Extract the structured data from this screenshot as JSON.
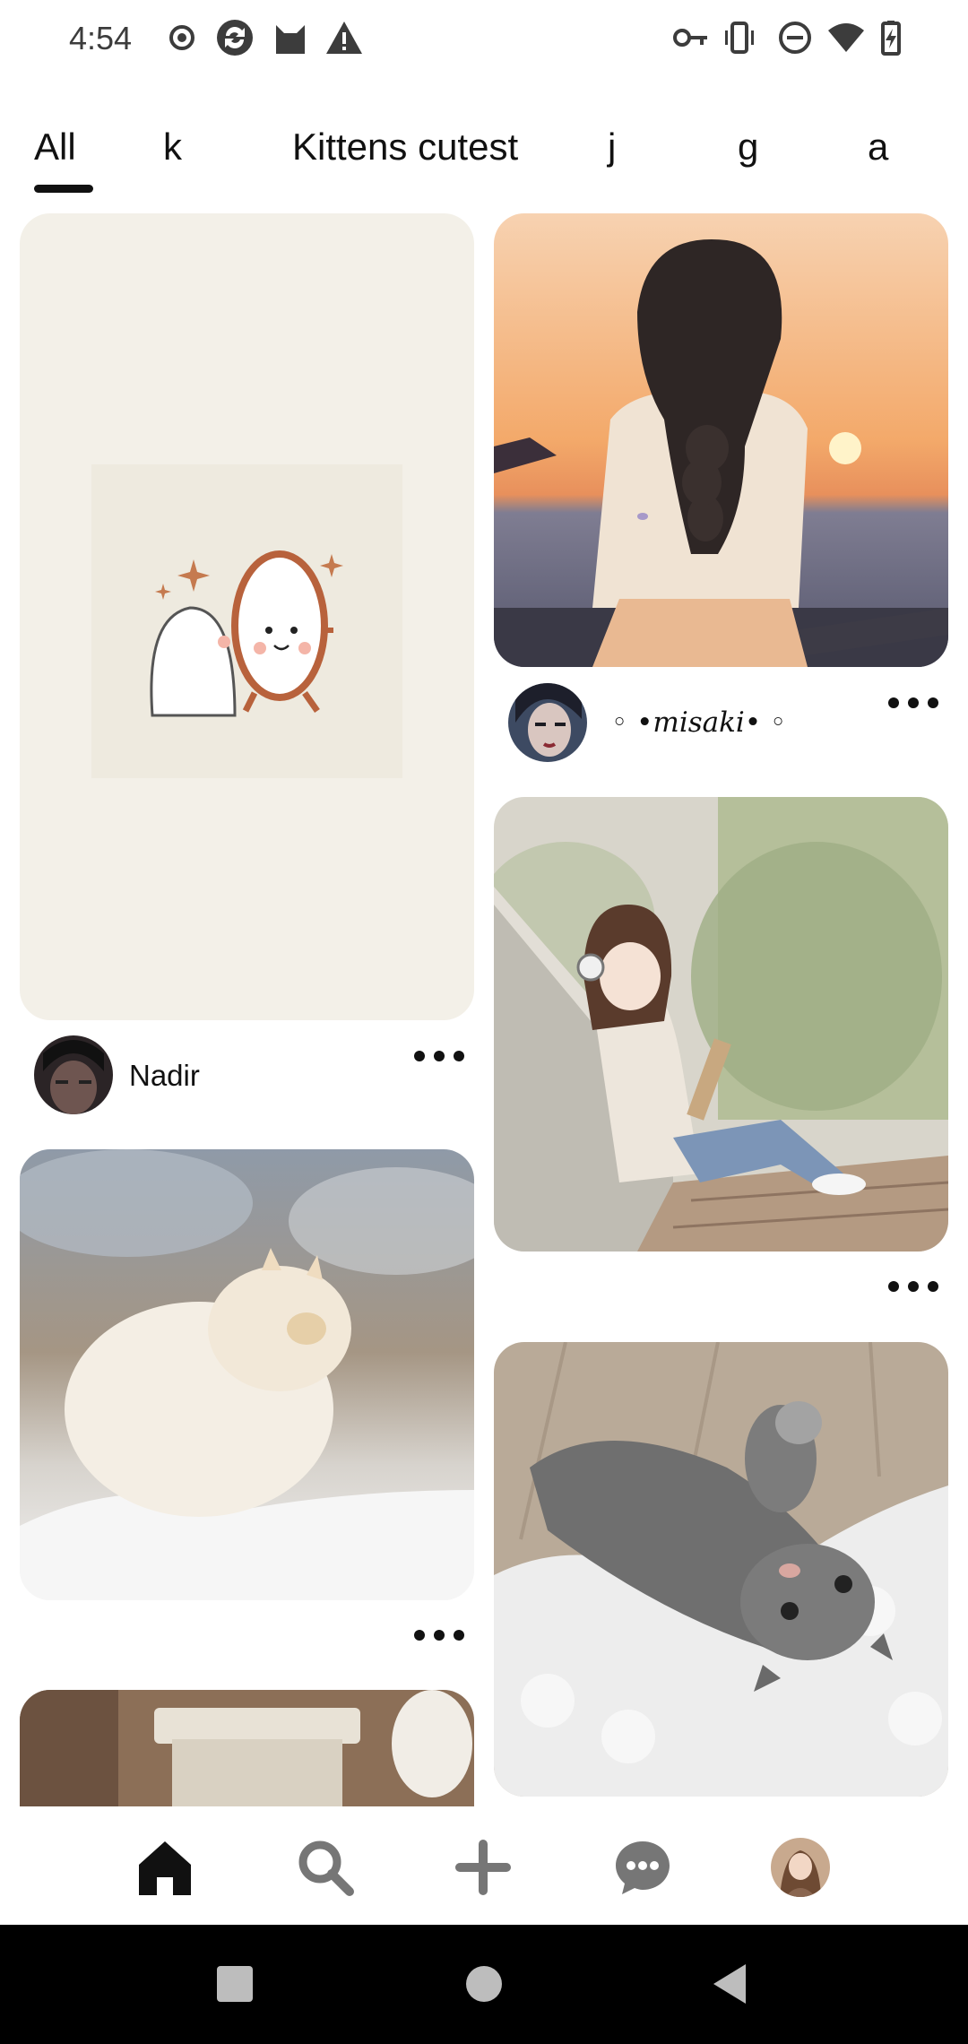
{
  "status_bar": {
    "time": "4:54",
    "left_icons": [
      "record-icon",
      "sync-app-icon",
      "cat-app-icon",
      "warning-icon"
    ],
    "right_icons": [
      "vpn-key-icon",
      "vibrate-icon",
      "do-not-disturb-icon",
      "wifi-icon",
      "battery-charging-icon"
    ]
  },
  "tabs": [
    {
      "label": "All",
      "selected": true
    },
    {
      "label": "k",
      "selected": false
    },
    {
      "label": "Kittens cutest",
      "selected": false
    },
    {
      "label": "j",
      "selected": false
    },
    {
      "label": "g",
      "selected": false
    },
    {
      "label": "a",
      "selected": false
    }
  ],
  "pins": [
    {
      "image": "ghost-mirror-illustration",
      "author": "Nadir"
    },
    {
      "image": "white-cat-in-snow-photo",
      "author": ""
    },
    {
      "image": "room-interior-photo",
      "author": ""
    },
    {
      "image": "girl-braid-sunset-illustration",
      "author": "◦ •misaki• ◦"
    },
    {
      "image": "girl-headphones-sketching-illustration",
      "author": ""
    },
    {
      "image": "grey-kitten-on-rug-photo",
      "author": ""
    }
  ],
  "bottom_nav": {
    "items": [
      "home-icon",
      "search-icon",
      "create-icon",
      "messages-icon",
      "profile-avatar"
    ],
    "active": "home-icon"
  },
  "system_nav": [
    "recents-button",
    "home-button",
    "back-button"
  ],
  "colors": {
    "text": "#111111",
    "background": "#ffffff",
    "system_nav": "#000000",
    "ghost_card": "#f3f0e8"
  }
}
